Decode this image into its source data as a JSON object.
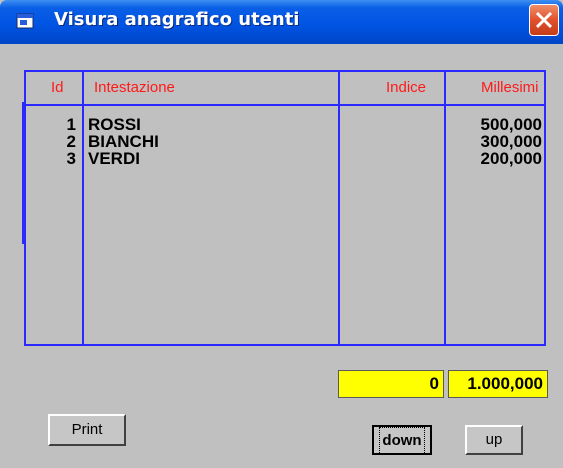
{
  "window": {
    "title": "Visura anagrafico utenti"
  },
  "grid": {
    "headers": {
      "id": "Id",
      "name": "Intestazione",
      "index": "Indice",
      "millesimi": "Millesimi"
    },
    "rows": [
      {
        "id": "1",
        "name": "ROSSI",
        "index": "",
        "millesimi": "500,000"
      },
      {
        "id": "2",
        "name": "BIANCHI",
        "index": "",
        "millesimi": "300,000"
      },
      {
        "id": "3",
        "name": "VERDI",
        "index": "",
        "millesimi": "200,000"
      }
    ]
  },
  "totals": {
    "index_total": "0",
    "millesimi_total": "1.000,000"
  },
  "buttons": {
    "print": "Print",
    "down": "down",
    "up": "up"
  },
  "colors": {
    "title_bar": "#0054e3",
    "grid_lines": "#2a2aff",
    "header_text": "#ff1a1a",
    "totals_bg": "#ffff00",
    "close_button": "#e1502b"
  },
  "icons": {
    "app": "window-icon",
    "close": "close-icon"
  }
}
